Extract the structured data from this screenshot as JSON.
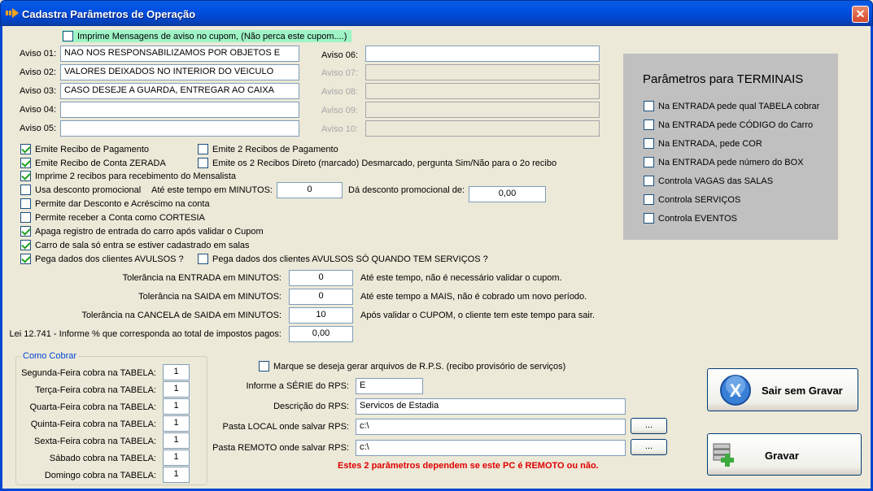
{
  "window": {
    "title": "Cadastra Parâmetros de Operação",
    "close": "✕"
  },
  "msg_checkbox": "Imprime Mensagens de aviso no cupom, (Não perca este cupom....)",
  "avisos_left": [
    {
      "label": "Aviso 01:",
      "value": "NAO NOS RESPONSABILIZAMOS POR OBJETOS E"
    },
    {
      "label": "Aviso 02:",
      "value": "VALORES DEIXADOS NO INTERIOR DO VEICULO"
    },
    {
      "label": "Aviso 03:",
      "value": "CASO DESEJE A GUARDA, ENTREGAR AO CAIXA"
    },
    {
      "label": "Aviso 04:",
      "value": ""
    },
    {
      "label": "Aviso 05:",
      "value": ""
    }
  ],
  "avisos_right": [
    {
      "label": "Aviso 06:",
      "value": ""
    },
    {
      "label": "Aviso 07:",
      "value": ""
    },
    {
      "label": "Aviso 08:",
      "value": ""
    },
    {
      "label": "Aviso 09:",
      "value": ""
    },
    {
      "label": "Aviso 10:",
      "value": ""
    }
  ],
  "options": {
    "emite_recibo": "Emite Recibo de Pagamento",
    "emite_2_recibos": "Emite 2 Recibos de Pagamento",
    "emite_recibo_zerada": "Emite Recibo de Conta ZERADA",
    "emite_2_direto": "Emite os 2 Recibos Direto (marcado)  Desmarcado, pergunta Sim/Não para o 2o recibo",
    "imprime_2_mensalista": "Imprime 2 recibos para recebimento do Mensalista",
    "usa_desconto": "Usa desconto promocional",
    "ate_tempo_label": "Até este tempo em MINUTOS:",
    "ate_tempo_value": "0",
    "da_desconto_label": "Dá desconto promocional de:",
    "da_desconto_value": "0,00",
    "permite_desconto": "Permite dar Desconto e Acréscimo na conta",
    "permite_cortesia": "Permite receber a Conta como CORTESIA",
    "apaga_registro": "Apaga registro de entrada do carro após validar o Cupom",
    "carro_sala": "Carro de sala só entra se estiver cadastrado em salas",
    "pega_avulsos": "Pega dados dos clientes AVULSOS ?",
    "pega_avulsos_servicos": "Pega dados dos clientes AVULSOS SÓ QUANDO TEM SERVIÇOS ?"
  },
  "tolerancias": [
    {
      "label": "Tolerância na ENTRADA em MINUTOS:",
      "value": "0",
      "note": "Até este tempo, não é necessário validar o cupom."
    },
    {
      "label": "Tolerância na SAIDA em MINUTOS:",
      "value": "0",
      "note": "Até este tempo a MAIS, não é cobrado um novo período."
    },
    {
      "label": "Tolerância na CANCELA de SAIDA em MINUTOS:",
      "value": "10",
      "note": "Após validar o CUPOM, o cliente tem este tempo para sair."
    },
    {
      "label": "Lei 12.741 - Informe % que corresponda ao total de impostos pagos:",
      "value": "0,00",
      "note": ""
    }
  ],
  "terminais": {
    "title": "Parâmetros para TERMINAIS",
    "items": [
      "Na ENTRADA pede qual TABELA cobrar",
      "Na ENTRADA pede CÓDIGO do Carro",
      "Na ENTRADA, pede COR",
      "Na ENTRADA pede número do BOX",
      "Controla VAGAS das SALAS",
      "Controla SERVIÇOS",
      "Controla EVENTOS"
    ]
  },
  "como_cobrar": {
    "title": "Como Cobrar",
    "rows": [
      {
        "label": "Segunda-Feira cobra na TABELA:",
        "value": "1"
      },
      {
        "label": "Terça-Feira cobra na TABELA:",
        "value": "1"
      },
      {
        "label": "Quarta-Feira cobra na TABELA:",
        "value": "1"
      },
      {
        "label": "Quinta-Feira cobra na TABELA:",
        "value": "1"
      },
      {
        "label": "Sexta-Feira cobra na TABELA:",
        "value": "1"
      },
      {
        "label": "Sábado cobra na TABELA:",
        "value": "1"
      },
      {
        "label": "Domingo cobra na TABELA:",
        "value": "1"
      }
    ]
  },
  "rps": {
    "checkbox": "Marque se deseja gerar arquivos de R.P.S.  (recibo provisório de serviços)",
    "serie_label": "Informe a SÉRIE do RPS:",
    "serie_value": "E",
    "descricao_label": "Descrição do RPS:",
    "descricao_value": "Servicos de Estadia",
    "local_label": "Pasta LOCAL onde salvar RPS:",
    "local_value": "c:\\",
    "remoto_label": "Pasta REMOTO onde salvar RPS:",
    "remoto_value": "c:\\",
    "browse": "...",
    "warning": "Estes 2 parâmetros dependem se este PC é REMOTO ou não."
  },
  "buttons": {
    "sair": "Sair sem Gravar",
    "gravar": "Gravar"
  }
}
